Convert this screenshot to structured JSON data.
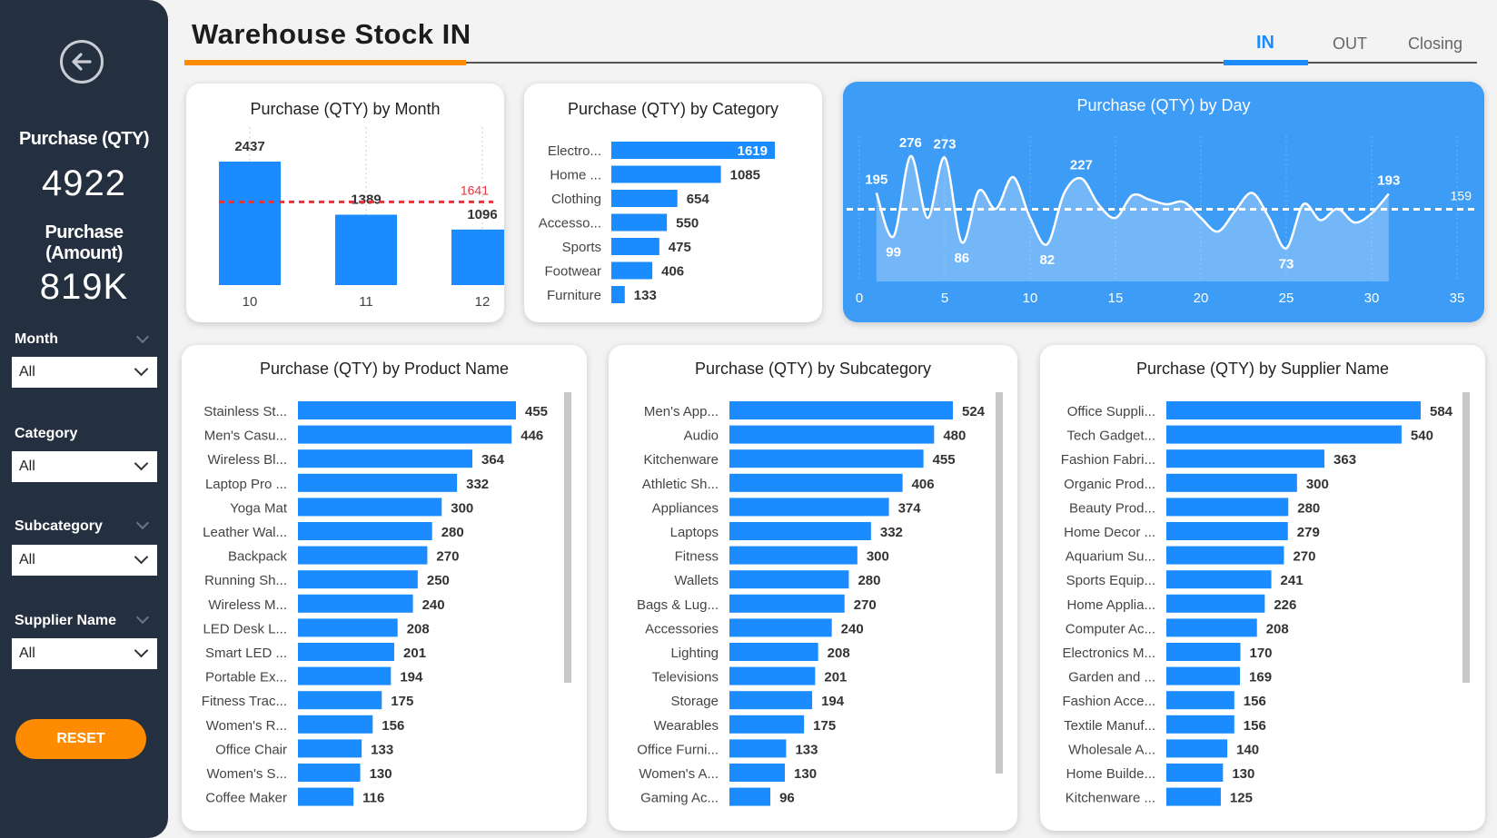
{
  "header": {
    "title": "Warehouse Stock IN"
  },
  "tabs": [
    {
      "label": "IN",
      "active": true
    },
    {
      "label": "OUT",
      "active": false
    },
    {
      "label": "Closing",
      "active": false
    }
  ],
  "sidebar": {
    "back_icon": "arrow-left-circle-icon",
    "kpi_qty_label": "Purchase (QTY)",
    "kpi_qty_value": "4922",
    "kpi_amount_label_1": "Purchase",
    "kpi_amount_label_2": "(Amount)",
    "kpi_amount_value": "819K",
    "filters": [
      {
        "label": "Month",
        "value": "All"
      },
      {
        "label": "Category",
        "value": "All"
      },
      {
        "label": "Subcategory",
        "value": "All"
      },
      {
        "label": "Supplier Name",
        "value": "All"
      }
    ],
    "reset_label": "RESET",
    "colors": {
      "bg": "#243040",
      "reset": "#ff8c00"
    }
  },
  "colors": {
    "bar": "#1a8cff",
    "accent": "#ff8c00",
    "avg_line": "#e8323c",
    "day_card": "#3d9cf5"
  },
  "chart_data": [
    {
      "id": "month",
      "type": "bar",
      "title": "Purchase (QTY) by Month",
      "categories": [
        "10",
        "11",
        "12"
      ],
      "values": [
        2437,
        1389,
        1096
      ],
      "data_labels": [
        "2437",
        "1389",
        "1096"
      ],
      "average": 1641,
      "average_label": "1641",
      "ylim": [
        0,
        2437
      ]
    },
    {
      "id": "category",
      "type": "bar",
      "orientation": "horizontal",
      "title": "Purchase (QTY) by Category",
      "categories": [
        "Electro...",
        "Home ...",
        "Clothing",
        "Accesso...",
        "Sports",
        "Footwear",
        "Furniture"
      ],
      "values": [
        1619,
        1085,
        654,
        550,
        475,
        406,
        133
      ]
    },
    {
      "id": "day",
      "type": "area",
      "title": "Purchase (QTY) by Day",
      "x": [
        1,
        2,
        3,
        4,
        5,
        6,
        7,
        8,
        9,
        10,
        11,
        12,
        13,
        14,
        15,
        16,
        17,
        18,
        19,
        20,
        21,
        22,
        23,
        24,
        25,
        26,
        27,
        28,
        29,
        30,
        31
      ],
      "values": [
        195,
        99,
        276,
        140,
        273,
        86,
        200,
        160,
        230,
        140,
        82,
        195,
        227,
        170,
        140,
        190,
        180,
        170,
        175,
        140,
        110,
        155,
        195,
        140,
        73,
        170,
        135,
        160,
        130,
        150,
        193
      ],
      "point_labels": [
        {
          "x": 1,
          "y": 195,
          "label": "195"
        },
        {
          "x": 2,
          "y": 99,
          "label": "99"
        },
        {
          "x": 3,
          "y": 276,
          "label": "276"
        },
        {
          "x": 5,
          "y": 273,
          "label": "273"
        },
        {
          "x": 6,
          "y": 86,
          "label": "86"
        },
        {
          "x": 11,
          "y": 82,
          "label": "82"
        },
        {
          "x": 13,
          "y": 227,
          "label": "227"
        },
        {
          "x": 25,
          "y": 73,
          "label": "73"
        },
        {
          "x": 31,
          "y": 193,
          "label": "193"
        }
      ],
      "average": 159,
      "average_label": "159",
      "xticks": [
        "0",
        "5",
        "10",
        "15",
        "20",
        "25",
        "30",
        "35"
      ],
      "xlim": [
        0,
        35
      ],
      "ylim": [
        0,
        300
      ]
    },
    {
      "id": "product",
      "type": "bar",
      "orientation": "horizontal",
      "title": "Purchase (QTY) by Product Name",
      "categories": [
        "Stainless St...",
        "Men's Casu...",
        "Wireless Bl...",
        "Laptop Pro ...",
        "Yoga Mat",
        "Leather Wal...",
        "Backpack",
        "Running Sh...",
        "Wireless M...",
        "LED Desk L...",
        "Smart LED ...",
        "Portable Ex...",
        "Fitness Trac...",
        "Women's R...",
        "Office Chair",
        "Women's S...",
        "Coffee Maker"
      ],
      "values": [
        455,
        446,
        364,
        332,
        300,
        280,
        270,
        250,
        240,
        208,
        201,
        194,
        175,
        156,
        133,
        130,
        116
      ]
    },
    {
      "id": "subcategory",
      "type": "bar",
      "orientation": "horizontal",
      "title": "Purchase (QTY) by Subcategory",
      "categories": [
        "Men's App...",
        "Audio",
        "Kitchenware",
        "Athletic Sh...",
        "Appliances",
        "Laptops",
        "Fitness",
        "Wallets",
        "Bags & Lug...",
        "Accessories",
        "Lighting",
        "Televisions",
        "Storage",
        "Wearables",
        "Office Furni...",
        "Women's A...",
        "Gaming Ac..."
      ],
      "values": [
        524,
        480,
        455,
        406,
        374,
        332,
        300,
        280,
        270,
        240,
        208,
        201,
        194,
        175,
        133,
        130,
        96
      ]
    },
    {
      "id": "supplier",
      "type": "bar",
      "orientation": "horizontal",
      "title": "Purchase (QTY) by Supplier Name",
      "categories": [
        "Office Suppli...",
        "Tech Gadget...",
        "Fashion Fabri...",
        "Organic Prod...",
        "Beauty Prod...",
        "Home Decor ...",
        "Aquarium Su...",
        "Sports Equip...",
        "Home Applia...",
        "Computer Ac...",
        "Electronics M...",
        "Garden and ...",
        "Fashion Acce...",
        "Textile Manuf...",
        "Wholesale A...",
        "Home Builde...",
        "Kitchenware ..."
      ],
      "values": [
        584,
        540,
        363,
        300,
        280,
        279,
        270,
        241,
        226,
        208,
        170,
        169,
        156,
        156,
        140,
        130,
        125
      ]
    }
  ]
}
